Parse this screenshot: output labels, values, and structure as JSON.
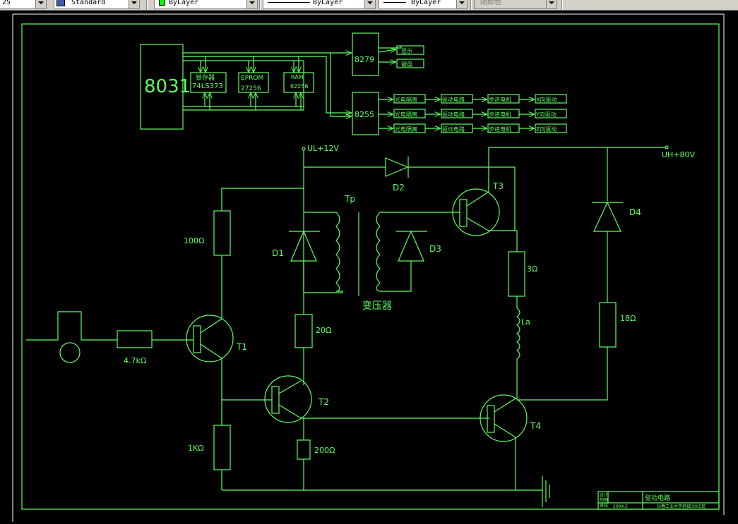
{
  "toolbar": {
    "dimstyle_value": "25",
    "textstyle_value": "Standard",
    "layer_value": "ByLayer",
    "linetype_value": "ByLayer",
    "lineweight_value": "ByLayer",
    "plotstyle_value": "随颜色",
    "layer_color": "#00ff00"
  },
  "colors": {
    "background": "#000000",
    "drawing": "#5fff5f",
    "frame": "#ffffff"
  },
  "block_diagram": {
    "cpu": "8031",
    "latch_line1": "锁存器",
    "latch_line2": "74LS373",
    "eprom_line1": "EPROM",
    "eprom_line2": "27256",
    "ram_line1": "RAM",
    "ram_line2": "62256",
    "kbd_ctrl": "8279",
    "display": "显示",
    "keyboard": "键盘",
    "ppi": "8255",
    "channels": [
      {
        "isolation": "光电隔离",
        "driver": "驱动电路",
        "motor": "步进电机",
        "axis": "X向驱动"
      },
      {
        "isolation": "光电隔离",
        "driver": "驱动电路",
        "motor": "步进电机",
        "axis": "Y向驱动"
      },
      {
        "isolation": "光电隔离",
        "driver": "驱动电路",
        "motor": "步进电机",
        "axis": "Z向驱动"
      }
    ]
  },
  "circuit": {
    "ul_supply": "UL+12V",
    "uh_supply": "UH+80V",
    "r_base": "4.7kΩ",
    "r_100": "100Ω",
    "r_1k": "1KΩ",
    "r_20": "20Ω",
    "r_200": "200Ω",
    "r_3": "3Ω",
    "r_18": "18Ω",
    "inductor": "La",
    "t1": "T1",
    "t2": "T2",
    "t3": "T3",
    "t4": "T4",
    "d1": "D1",
    "d2": "D2",
    "d3": "D3",
    "d4": "D4",
    "tp": "Tp",
    "transformer": "变压器"
  },
  "title_block": {
    "drawing_name": "驱动电路",
    "row1": "设计",
    "row2": "制图",
    "row3": "审核",
    "date": "2004.5",
    "school": "长春工业大学机械0005班"
  }
}
